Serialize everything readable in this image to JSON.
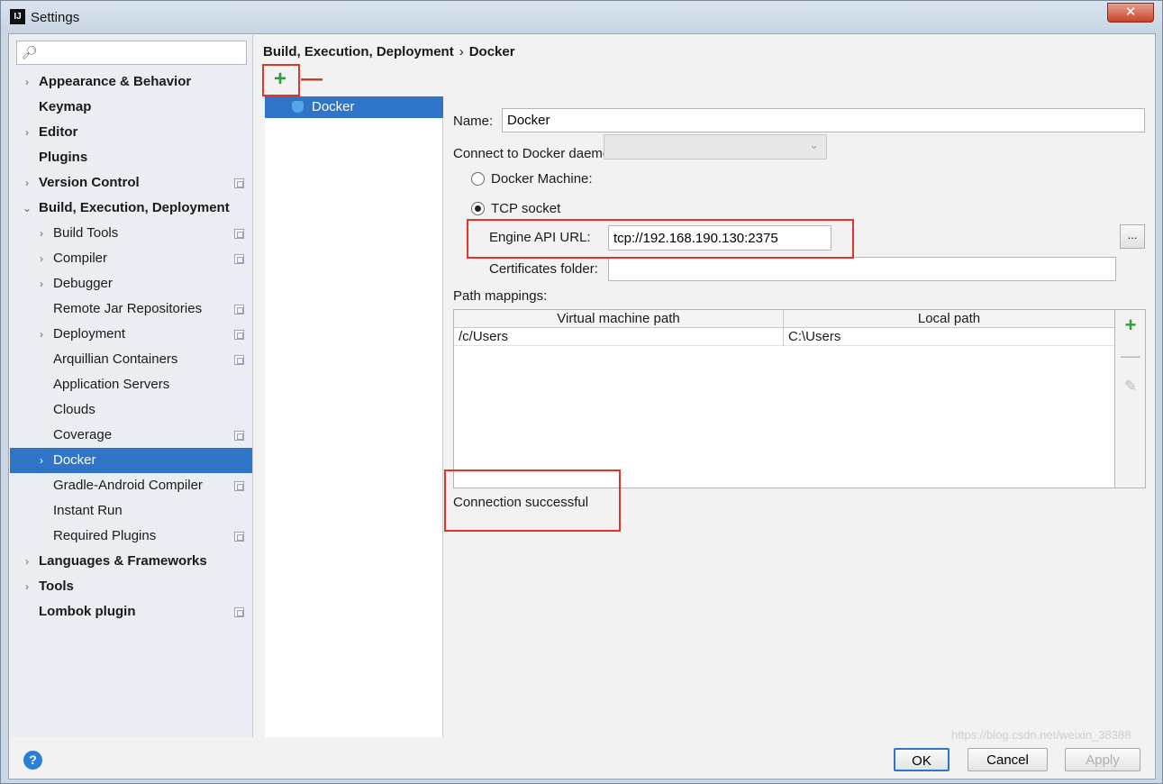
{
  "window": {
    "title": "Settings",
    "close_label": "✕"
  },
  "search": {
    "placeholder": ""
  },
  "sidebar": {
    "items": [
      {
        "label": "Appearance & Behavior",
        "arrow": "›",
        "bold": true,
        "level": 0
      },
      {
        "label": "Keymap",
        "arrow": "",
        "bold": true,
        "level": 0
      },
      {
        "label": "Editor",
        "arrow": "›",
        "bold": true,
        "level": 0
      },
      {
        "label": "Plugins",
        "arrow": "",
        "bold": true,
        "level": 0
      },
      {
        "label": "Version Control",
        "arrow": "›",
        "bold": true,
        "level": 0,
        "proj": true
      },
      {
        "label": "Build, Execution, Deployment",
        "arrow": "⌄",
        "bold": true,
        "level": 0
      },
      {
        "label": "Build Tools",
        "arrow": "›",
        "bold": false,
        "level": 1,
        "proj": true
      },
      {
        "label": "Compiler",
        "arrow": "›",
        "bold": false,
        "level": 1,
        "proj": true
      },
      {
        "label": "Debugger",
        "arrow": "›",
        "bold": false,
        "level": 1
      },
      {
        "label": "Remote Jar Repositories",
        "arrow": "",
        "bold": false,
        "level": 1,
        "proj": true
      },
      {
        "label": "Deployment",
        "arrow": "›",
        "bold": false,
        "level": 1,
        "proj": true
      },
      {
        "label": "Arquillian Containers",
        "arrow": "",
        "bold": false,
        "level": 1,
        "proj": true
      },
      {
        "label": "Application Servers",
        "arrow": "",
        "bold": false,
        "level": 1
      },
      {
        "label": "Clouds",
        "arrow": "",
        "bold": false,
        "level": 1
      },
      {
        "label": "Coverage",
        "arrow": "",
        "bold": false,
        "level": 1,
        "proj": true
      },
      {
        "label": "Docker",
        "arrow": "›",
        "bold": false,
        "level": 1,
        "selected": true
      },
      {
        "label": "Gradle-Android Compiler",
        "arrow": "",
        "bold": false,
        "level": 1,
        "proj": true
      },
      {
        "label": "Instant Run",
        "arrow": "",
        "bold": false,
        "level": 1
      },
      {
        "label": "Required Plugins",
        "arrow": "",
        "bold": false,
        "level": 1,
        "proj": true
      },
      {
        "label": "Languages & Frameworks",
        "arrow": "›",
        "bold": true,
        "level": 0
      },
      {
        "label": "Tools",
        "arrow": "›",
        "bold": true,
        "level": 0
      },
      {
        "label": "Lombok plugin",
        "arrow": "",
        "bold": true,
        "level": 0,
        "proj": true
      }
    ]
  },
  "breadcrumb": {
    "parent": "Build, Execution, Deployment",
    "separator": "›",
    "current": "Docker"
  },
  "list": {
    "add_label": "+",
    "remove_label": "—",
    "items": [
      "Docker"
    ]
  },
  "form": {
    "name_label": "Name:",
    "name_value": "Docker",
    "connect_label": "Connect to Docker daemon with:",
    "docker_machine_label": "Docker Machine:",
    "tcp_socket_label": "TCP socket",
    "engine_api_label": "Engine API URL:",
    "engine_api_value": "tcp://192.168.190.130:2375",
    "certificates_label": "Certificates folder:",
    "certificates_value": "",
    "browse_label": "...",
    "path_mappings_label": "Path mappings:",
    "table": {
      "columns": [
        "Virtual machine path",
        "Local path"
      ],
      "rows": [
        [
          "/c/Users",
          "C:\\Users"
        ]
      ]
    },
    "status": "Connection successful"
  },
  "footer": {
    "help_label": "?",
    "ok_label": "OK",
    "cancel_label": "Cancel",
    "apply_label": "Apply",
    "watermark": "https://blog.csdn.net/weixin_38388"
  },
  "colors": {
    "accent": "#2f74c6",
    "highlight": "#e53327",
    "add": "#2aa039"
  }
}
